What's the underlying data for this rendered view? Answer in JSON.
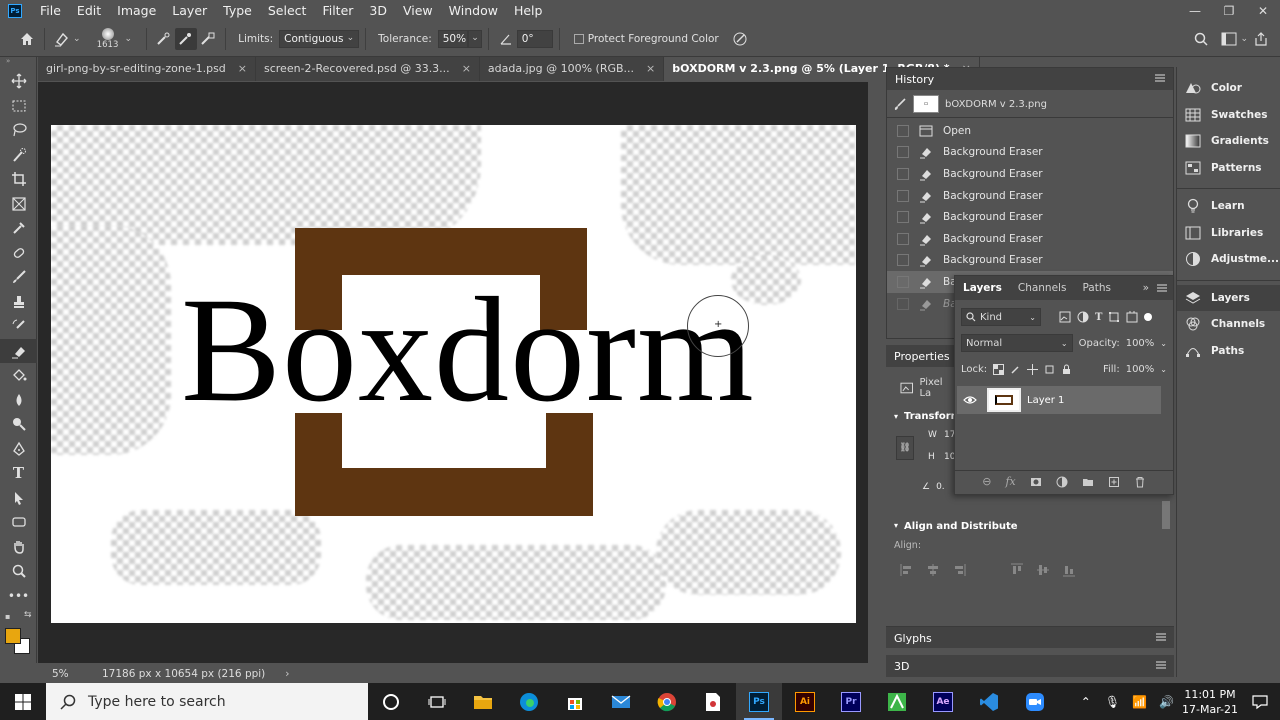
{
  "app": {
    "logo": "Ps"
  },
  "menu": [
    "File",
    "Edit",
    "Image",
    "Layer",
    "Type",
    "Select",
    "Filter",
    "3D",
    "View",
    "Window",
    "Help"
  ],
  "options": {
    "brush_size": "1613",
    "limits_label": "Limits:",
    "limits_value": "Contiguous",
    "tolerance_label": "Tolerance:",
    "tolerance_value": "50%",
    "angle_value": "0°",
    "protect_label": "Protect Foreground Color"
  },
  "tabs": [
    {
      "label": "girl-png-by-sr-editing-zone-1.psd",
      "close": "×"
    },
    {
      "label": "screen-2-Recovered.psd @ 33.3...",
      "close": "×"
    },
    {
      "label": "adada.jpg @ 100% (RGB...",
      "close": "×"
    },
    {
      "label": "bOXDORM v 2.3.png @ 5% (Layer 1, RGB/8) *",
      "close": "×"
    }
  ],
  "canvas": {
    "logo_text": "Boxdorm",
    "brand_color": "#5e3511"
  },
  "status": {
    "zoom": "5%",
    "doc_info": "17186 px x 10654 px (216 ppi)",
    "arrow": "›"
  },
  "history": {
    "title": "History",
    "snapshot": "bOXDORM v 2.3.png",
    "items": [
      "Open",
      "Background Eraser",
      "Background Eraser",
      "Background Eraser",
      "Background Eraser",
      "Background Eraser",
      "Background Eraser"
    ],
    "partial": [
      "Ba",
      "Ba"
    ]
  },
  "properties": {
    "title": "Properties",
    "pixel_label": "Pixel La",
    "transform_label": "Transform",
    "w_label": "W",
    "w_value": "17",
    "h_label": "H",
    "h_value": "10",
    "angle_value": "0."
  },
  "layers": {
    "tabs": [
      "Layers",
      "Channels",
      "Paths"
    ],
    "kind_label": "Kind",
    "blend_mode": "Normal",
    "opacity_label": "Opacity:",
    "opacity_value": "100%",
    "lock_label": "Lock:",
    "fill_label": "Fill:",
    "fill_value": "100%",
    "layer_name": "Layer 1",
    "footer_fx": "fx"
  },
  "align": {
    "title": "Align and Distribute",
    "align_label": "Align:"
  },
  "glyphs": {
    "title": "Glyphs"
  },
  "three_d": {
    "title": "3D"
  },
  "right_panels": [
    "Color",
    "Swatches",
    "Gradients",
    "Patterns",
    "Learn",
    "Libraries",
    "Adjustme...",
    "Layers",
    "Channels",
    "Paths"
  ],
  "taskbar": {
    "search_placeholder": "Type here to search",
    "time": "11:01 PM",
    "date": "17-Mar-21"
  }
}
